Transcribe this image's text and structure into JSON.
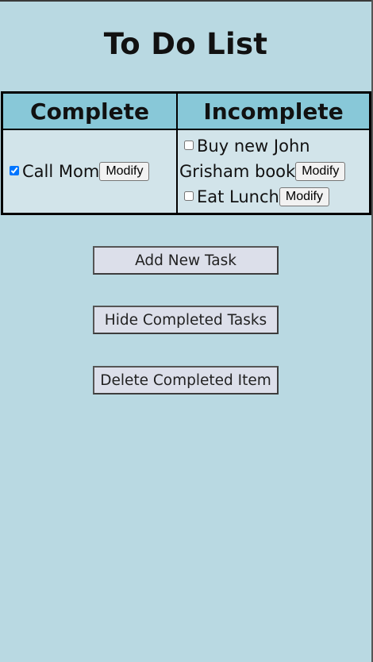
{
  "title": "To Do List",
  "columns": {
    "complete": "Complete",
    "incomplete": "Incomplete"
  },
  "complete_tasks": [
    {
      "label": "Call Mom",
      "checked": true,
      "modify_label": "Modify"
    }
  ],
  "incomplete_tasks": [
    {
      "label": "Buy new John Grisham book",
      "checked": false,
      "modify_label": "Modify"
    },
    {
      "label": "Eat Lunch",
      "checked": false,
      "modify_label": "Modify"
    }
  ],
  "actions": {
    "add": "Add New Task",
    "hide": "Hide Completed Tasks",
    "delete": "Delete Completed Item"
  },
  "colors": {
    "page_background": "#b9d9e2",
    "header_background": "#88c8d8",
    "cell_background": "#d2e4ea",
    "button_background": "#dcdfea"
  }
}
